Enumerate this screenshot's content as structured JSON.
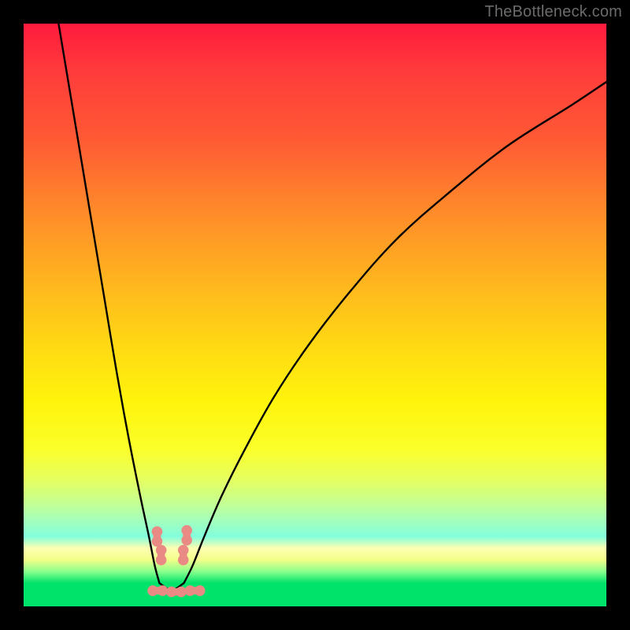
{
  "watermark": "TheBottleneck.com",
  "colors": {
    "frame": "#000000",
    "curve_stroke": "#000000",
    "marker_fill": "#e98b84",
    "marker_stroke": "#e98b84"
  },
  "chart_data": {
    "type": "line",
    "title": "",
    "xlabel": "",
    "ylabel": "",
    "xlim": [
      0,
      100
    ],
    "ylim": [
      0,
      100
    ],
    "note": "No axes or tick labels are rendered; values are normalized 0–100 in each axis. The curve is a V-shaped bottleneck profile with minimum near x≈25 and two branches rising toward the top edge.",
    "series": [
      {
        "name": "left-branch",
        "x": [
          6,
          8,
          10,
          12,
          14,
          16,
          18,
          20,
          21.5,
          22.5,
          23.3
        ],
        "y": [
          100,
          88,
          76,
          64,
          52,
          40,
          29,
          19,
          12,
          7,
          4
        ]
      },
      {
        "name": "right-branch",
        "x": [
          27.5,
          29,
          31,
          34,
          38,
          43,
          49,
          56,
          64,
          73,
          83,
          94,
          100
        ],
        "y": [
          4,
          7,
          12,
          19,
          27,
          36,
          45,
          54,
          63,
          71,
          79,
          86,
          90
        ]
      }
    ],
    "markers": [
      {
        "name": "left-pair-top",
        "x": 22.9,
        "y": 12.0,
        "shape": "peanut-vertical"
      },
      {
        "name": "left-pair-bottom",
        "x": 23.6,
        "y": 8.8,
        "shape": "peanut-vertical"
      },
      {
        "name": "right-pair-top",
        "x": 28.0,
        "y": 12.2,
        "shape": "peanut-vertical"
      },
      {
        "name": "right-pair-bottom",
        "x": 27.4,
        "y": 8.8,
        "shape": "peanut-vertical"
      },
      {
        "name": "bottom-left",
        "x": 23.0,
        "y": 2.7,
        "shape": "peanut-horizontal"
      },
      {
        "name": "bottom-mid",
        "x": 26.2,
        "y": 2.5,
        "shape": "peanut-horizontal"
      },
      {
        "name": "bottom-right",
        "x": 29.4,
        "y": 2.7,
        "shape": "peanut-horizontal"
      }
    ]
  }
}
